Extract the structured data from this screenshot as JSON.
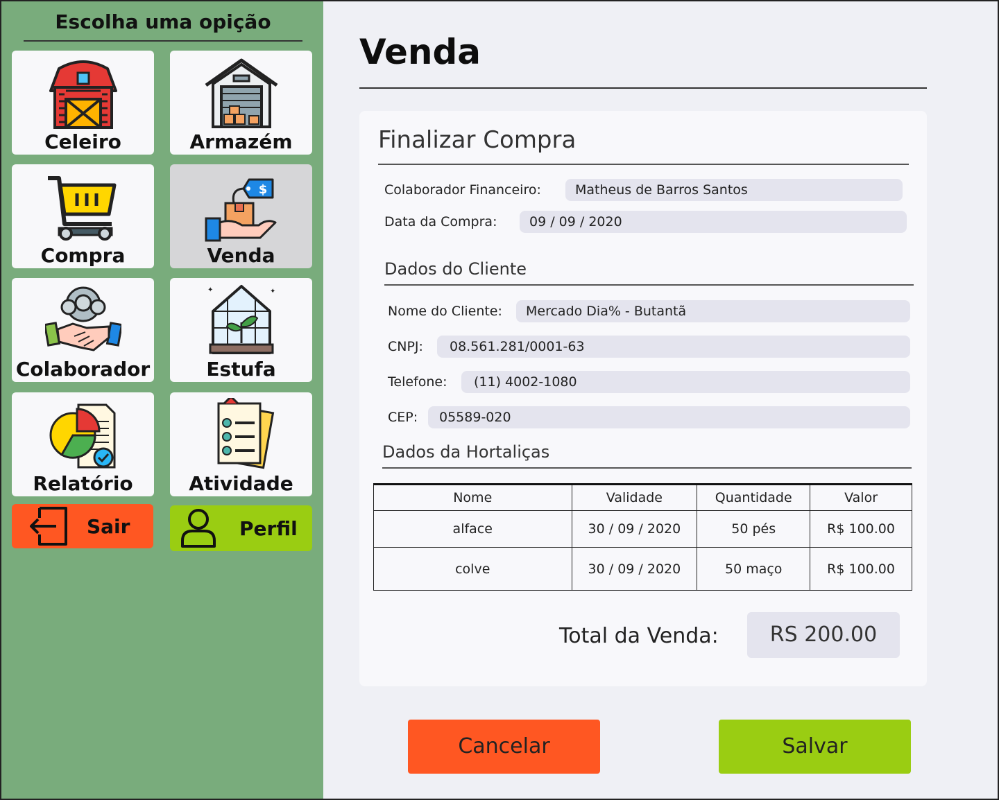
{
  "sidebar": {
    "title": "Escolha uma opição",
    "tiles": [
      {
        "label": "Celeiro"
      },
      {
        "label": "Armazém"
      },
      {
        "label": "Compra"
      },
      {
        "label": "Venda"
      },
      {
        "label": "Colaborador"
      },
      {
        "label": "Estufa"
      },
      {
        "label": "Relatório"
      },
      {
        "label": "Atividade"
      }
    ],
    "exit_label": "Sair",
    "profile_label": "Perfil"
  },
  "page": {
    "title": "Venda"
  },
  "card": {
    "title": "Finalizar Compra",
    "collaborator_label": "Colaborador Financeiro:",
    "collaborator_value": "Matheus de Barros Santos",
    "date_label": "Data da Compra:",
    "date_value": "09 / 09 / 2020",
    "client_section": "Dados do Cliente",
    "client_name_label": "Nome do Cliente:",
    "client_name_value": "Mercado Dia% - Butantã",
    "cnpj_label": "CNPJ:",
    "cnpj_value": "08.561.281/0001-63",
    "phone_label": "Telefone:",
    "phone_value": "(11) 4002-1080",
    "cep_label": "CEP:",
    "cep_value": "05589-020",
    "veg_section": "Dados da Hortaliças",
    "table": {
      "headers": [
        "Nome",
        "Validade",
        "Quantidade",
        "Valor"
      ],
      "rows": [
        [
          "alface",
          "30 / 09 / 2020",
          "50 pés",
          "R$ 100.00"
        ],
        [
          "colve",
          "30 / 09 / 2020",
          "50 maço",
          "R$ 100.00"
        ]
      ]
    },
    "total_label": "Total da Venda:",
    "total_value": "RS 200.00"
  },
  "actions": {
    "cancel_label": "Cancelar",
    "save_label": "Salvar"
  },
  "colors": {
    "sidebar_bg": "#79ac7c",
    "cancel": "#ff5722",
    "save": "#9acd12",
    "exit": "#ff5722",
    "profile": "#9acd12"
  }
}
